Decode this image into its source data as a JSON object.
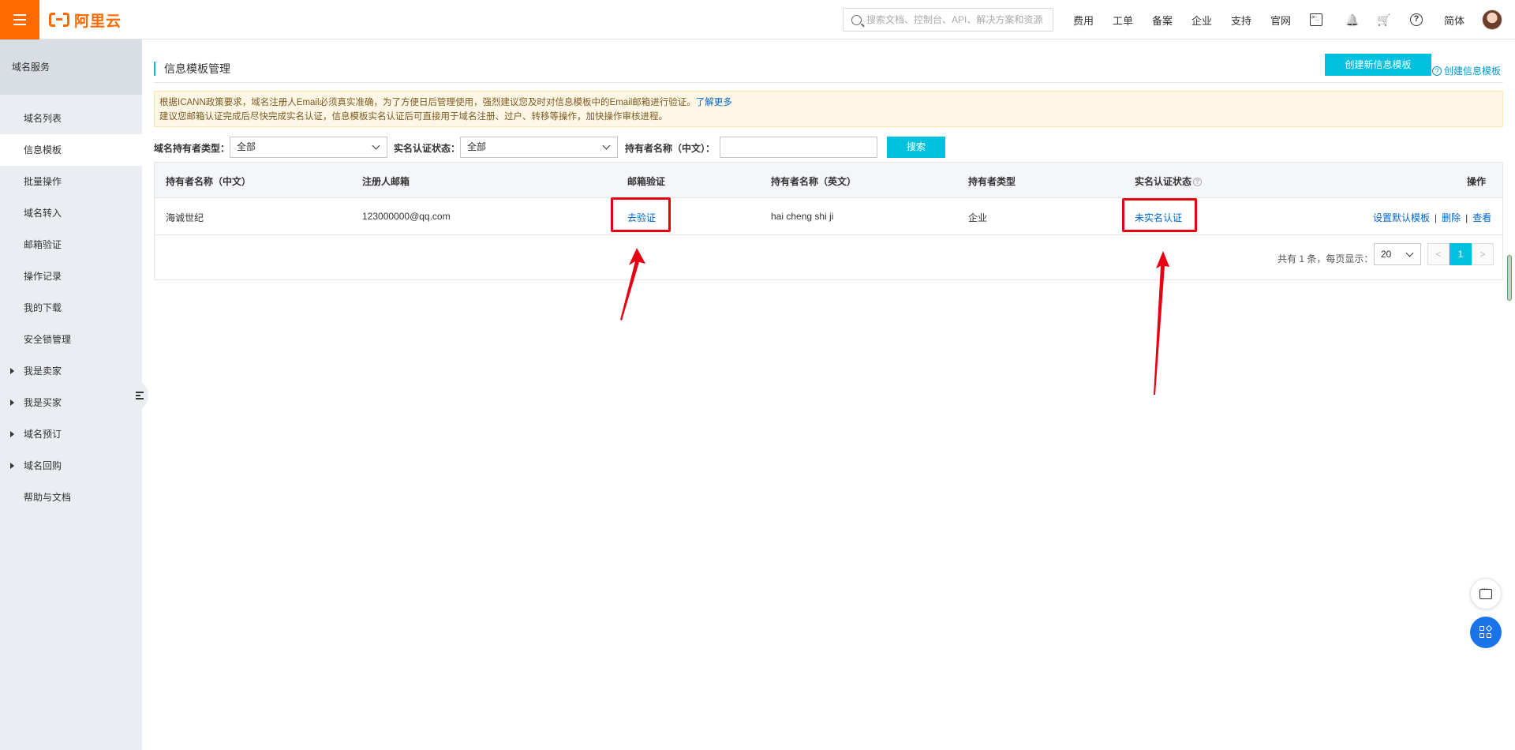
{
  "topbar": {
    "logo_text": "阿里云",
    "search_placeholder": "搜索文档、控制台、API、解决方案和资源",
    "nav": [
      "费用",
      "工单",
      "备案",
      "企业",
      "支持",
      "官网"
    ],
    "lang": "简体"
  },
  "sidebar": {
    "header": "域名服务",
    "items": [
      {
        "label": "域名列表"
      },
      {
        "label": "信息模板"
      },
      {
        "label": "批量操作"
      },
      {
        "label": "域名转入"
      },
      {
        "label": "邮箱验证"
      },
      {
        "label": "操作记录"
      },
      {
        "label": "我的下载"
      },
      {
        "label": "安全锁管理"
      },
      {
        "label": "我是卖家"
      },
      {
        "label": "我是买家"
      },
      {
        "label": "域名预订"
      },
      {
        "label": "域名回购"
      },
      {
        "label": "帮助与文档"
      }
    ]
  },
  "main": {
    "title": "信息模板管理",
    "create_button": "创建新信息模板",
    "create_help_link": "创建信息模板",
    "notice_line1": "根据ICANN政策要求，域名注册人Email必须真实准确，为了方便日后管理使用，强烈建议您及时对信息模板中的Email邮箱进行验证。",
    "notice_link": "了解更多",
    "notice_line2": "建议您邮箱认证完成后尽快完成实名认证，信息模板实名认证后可直接用于域名注册、过户、转移等操作，加快操作审核进程。",
    "filters": {
      "holder_type_label": "域名持有者类型：",
      "holder_type_value": "全部",
      "realname_label": "实名认证状态：",
      "realname_value": "全部",
      "holder_name_label": "持有者名称（中文）：",
      "holder_name_value": "",
      "search_button": "搜索"
    },
    "table": {
      "headers": [
        "持有者名称（中文）",
        "注册人邮箱",
        "邮箱验证",
        "持有者名称（英文）",
        "持有者类型",
        "实名认证状态",
        "操作"
      ],
      "rows": [
        {
          "name_cn": "海诚世纪",
          "email": "123000000@qq.com",
          "email_verify": "去验证",
          "name_en": "hai cheng shi ji",
          "holder_type": "企业",
          "realname_status": "未实名认证",
          "op_default": "设置默认模板",
          "op_delete": "删除",
          "op_view": "查看"
        }
      ]
    },
    "pagination": {
      "summary": "共有 1 条，每页显示：",
      "page_size": "20",
      "current_page": "1",
      "prev": "<",
      "next": ">"
    }
  },
  "colors": {
    "brand": "#ff6a00",
    "accent": "#00c1de",
    "highlight": "#e60012"
  }
}
